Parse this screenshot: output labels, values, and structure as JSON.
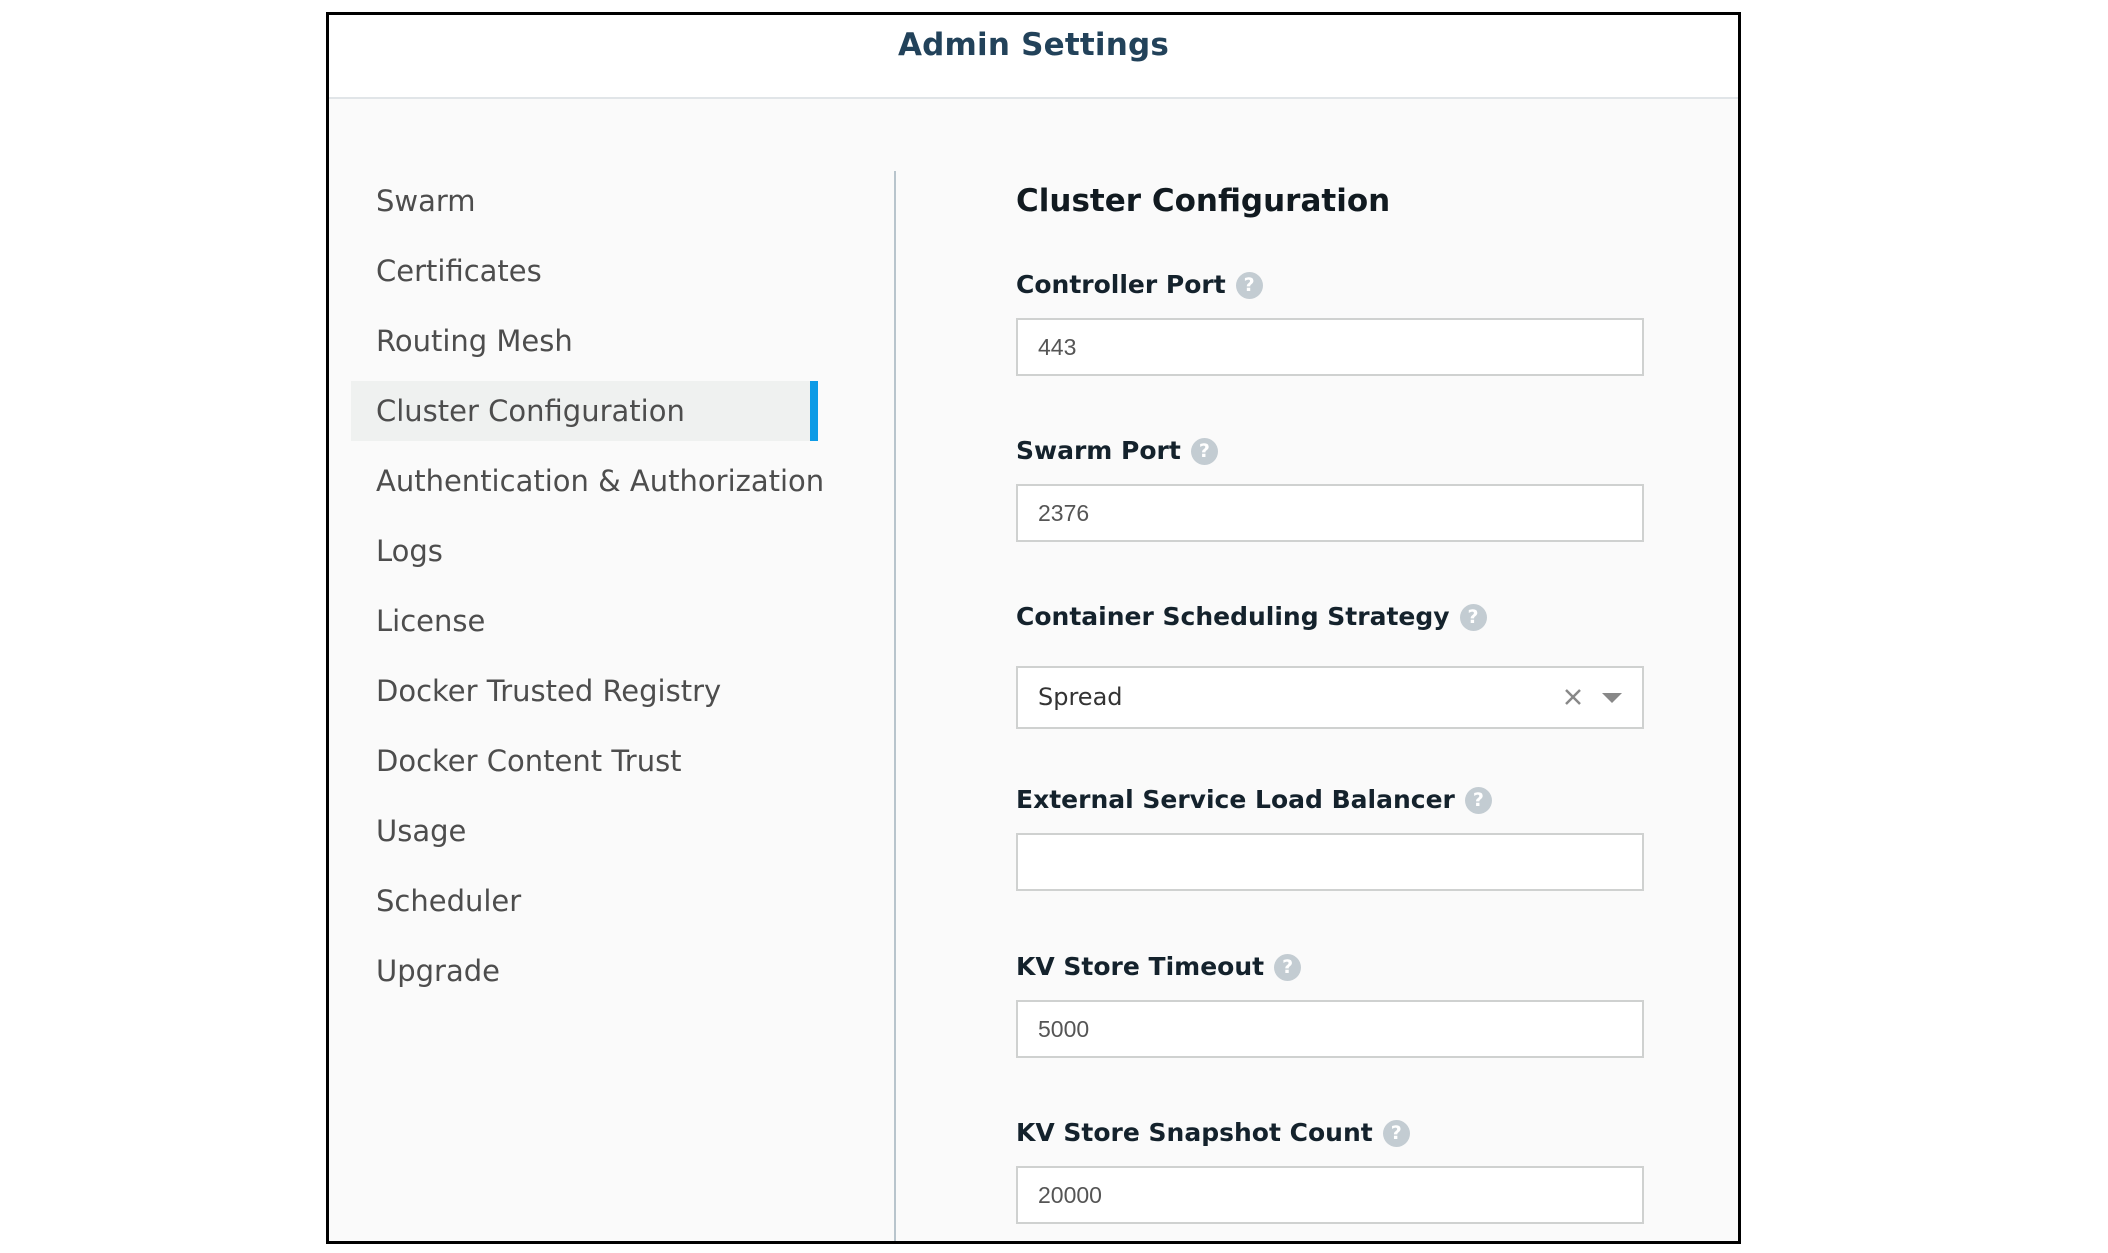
{
  "header": {
    "title": "Admin Settings"
  },
  "sidebar": {
    "active_index": 3,
    "accent_color": "#0d9be6",
    "items": [
      {
        "label": "Swarm"
      },
      {
        "label": "Certificates"
      },
      {
        "label": "Routing Mesh"
      },
      {
        "label": "Cluster Configuration"
      },
      {
        "label": "Authentication & Authorization"
      },
      {
        "label": "Logs"
      },
      {
        "label": "License"
      },
      {
        "label": "Docker Trusted Registry"
      },
      {
        "label": "Docker Content Trust"
      },
      {
        "label": "Usage"
      },
      {
        "label": "Scheduler"
      },
      {
        "label": "Upgrade"
      }
    ]
  },
  "main": {
    "section_title": "Cluster Configuration",
    "help_glyph": "?",
    "fields": {
      "controller_port": {
        "label": "Controller Port",
        "value": "443",
        "help_icon": "question-circle-icon"
      },
      "swarm_port": {
        "label": "Swarm Port",
        "value": "2376",
        "help_icon": "question-circle-icon"
      },
      "scheduling_strategy": {
        "label": "Container Scheduling Strategy",
        "selected": "Spread",
        "help_icon": "question-circle-icon",
        "clear_icon": "close-x-icon",
        "dropdown_icon": "caret-down-icon"
      },
      "external_lb": {
        "label": "External Service Load Balancer",
        "value": "",
        "help_icon": "question-circle-icon"
      },
      "kv_timeout": {
        "label": "KV Store Timeout",
        "value": "5000",
        "help_icon": "question-circle-icon"
      },
      "kv_snapshot_count": {
        "label": "KV Store Snapshot Count",
        "value": "20000",
        "help_icon": "question-circle-icon"
      }
    }
  }
}
